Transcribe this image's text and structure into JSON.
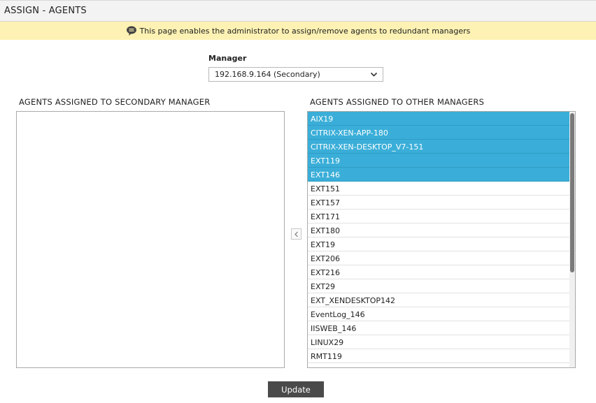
{
  "header": {
    "title": "ASSIGN - AGENTS"
  },
  "info": {
    "text": "This page enables the administrator to assign/remove agents to redundant managers",
    "icon": "chat-bubble-icon"
  },
  "manager": {
    "label": "Manager",
    "selected": "192.168.9.164 (Secondary)"
  },
  "left_panel": {
    "heading": "AGENTS ASSIGNED TO SECONDARY MANAGER",
    "items": []
  },
  "right_panel": {
    "heading": "AGENTS ASSIGNED TO OTHER MANAGERS",
    "items": [
      {
        "label": "AIX19",
        "selected": true
      },
      {
        "label": "CITRIX-XEN-APP-180",
        "selected": true
      },
      {
        "label": "CITRIX-XEN-DESKTOP_V7-151",
        "selected": true
      },
      {
        "label": "EXT119",
        "selected": true
      },
      {
        "label": "EXT146",
        "selected": true
      },
      {
        "label": "EXT151",
        "selected": false
      },
      {
        "label": "EXT157",
        "selected": false
      },
      {
        "label": "EXT171",
        "selected": false
      },
      {
        "label": "EXT180",
        "selected": false
      },
      {
        "label": "EXT19",
        "selected": false
      },
      {
        "label": "EXT206",
        "selected": false
      },
      {
        "label": "EXT216",
        "selected": false
      },
      {
        "label": "EXT29",
        "selected": false
      },
      {
        "label": "EXT_XENDESKTOP142",
        "selected": false
      },
      {
        "label": "EventLog_146",
        "selected": false
      },
      {
        "label": "IISWEB_146",
        "selected": false
      },
      {
        "label": "LINUX29",
        "selected": false
      },
      {
        "label": "RMT119",
        "selected": false
      }
    ]
  },
  "actions": {
    "update_label": "Update"
  },
  "colors": {
    "selected_row": "#3aaed8",
    "info_bar": "#fdf2b3",
    "button": "#4a4a4a"
  }
}
